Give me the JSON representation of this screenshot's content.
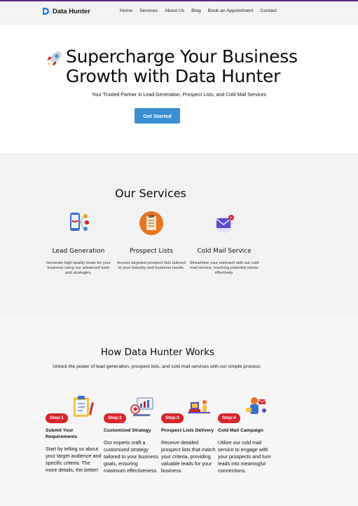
{
  "brand": {
    "name": "Data Hunter",
    "accent": "#3a8fd3"
  },
  "nav": {
    "items": [
      "Home",
      "Services",
      "About Us",
      "Blog",
      "Book an Appointment",
      "Contact"
    ]
  },
  "hero": {
    "title": "Supercharge Your Business Growth with Data Hunter",
    "subtitle": "Your Trusted Partner in Lead Generation, Prospect Lists, and Cold Mail Services",
    "cta": "Get Started"
  },
  "services": {
    "title": "Our Services",
    "items": [
      {
        "icon": "lead-generation-icon",
        "title": "Lead Generation",
        "text": "Generate high-quality leads for your business using our advanced tools and strategies."
      },
      {
        "icon": "prospect-list-icon",
        "title": "Prospect Lists",
        "text": "Access targeted prospect lists tailored to your industry and business needs."
      },
      {
        "icon": "cold-mail-icon",
        "title": "Cold Mail Service",
        "text": "Streamline your outreach with our cold mail service, reaching potential clients effectively."
      }
    ]
  },
  "works": {
    "title": "How Data Hunter Works",
    "intro": "Unlock the power of lead generation, prospect lists, and cold mail services with our simple process:",
    "steps": [
      {
        "badge": "Step:1",
        "icon": "clipboard-icon",
        "title": "Submit Your Requirements",
        "text": "Start by telling us about your target audience and specific criteria. The more details, the better!"
      },
      {
        "badge": "Step:2",
        "icon": "strategy-icon",
        "title": "Customized Strategy",
        "text": "Our experts craft a customized strategy tailored to your business goals, ensuring maximum effectiveness."
      },
      {
        "badge": "Step:3",
        "icon": "delivery-icon",
        "title": "Prospect Lists Delivery",
        "text": "Receive detailed prospect lists that match your criteria, providing valuable leads for your business."
      },
      {
        "badge": "Step:4",
        "icon": "campaign-icon",
        "title": "Cold Mail Campaign",
        "text": "Utilize our cold mail service to engage with your prospects and turn leads into meaningful connections."
      }
    ]
  },
  "colors": {
    "step_badge": "#d9252a",
    "button": "#3a8fd3",
    "section_bg": "#f2f2f2"
  }
}
